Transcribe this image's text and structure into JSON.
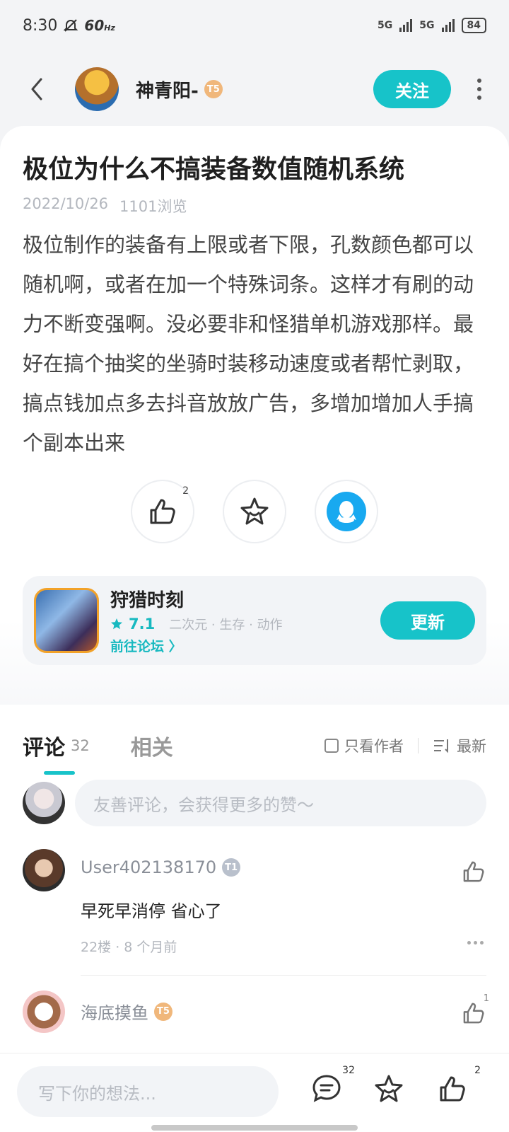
{
  "status_bar": {
    "time": "8:30",
    "refresh_rate": "60",
    "refresh_unit": "Hz",
    "network1": "5G",
    "network2": "5G",
    "battery": "84"
  },
  "header": {
    "author_name": "神青阳-",
    "author_level": "T5",
    "follow_label": "关注"
  },
  "post": {
    "title": "极位为什么不搞装备数值随机系统",
    "date": "2022/10/26",
    "views": "1101浏览",
    "body": "极位制作的装备有上限或者下限，孔数颜色都可以随机啊，或者在加一个特殊词条。这样才有刷的动力不断变强啊。没必要非和怪猎单机游戏那样。最好在搞个抽奖的坐骑时装移动速度或者帮忙剥取，搞点钱加点多去抖音放放广告，多增加增加人手搞个副本出来",
    "like_count": "2"
  },
  "game": {
    "name": "狩猎时刻",
    "rating": "7.1",
    "tags": "二次元 · 生存 · 动作",
    "forum_link": "前往论坛 〉",
    "update_label": "更新"
  },
  "comments_section": {
    "tab_comments": "评论",
    "tab_comments_count": "32",
    "tab_related": "相关",
    "filter_author_only": "只看作者",
    "sort_label": "最新",
    "input_placeholder": "友善评论，会获得更多的赞～",
    "items": [
      {
        "user": "User402138170",
        "level": "T1",
        "text": "早死早消停 省心了",
        "meta": "22楼 · 8 个月前",
        "likes": ""
      },
      {
        "user": "海底摸鱼",
        "level": "T5",
        "text": "",
        "meta": "",
        "likes": "1"
      }
    ]
  },
  "bottom_bar": {
    "input_placeholder": "写下你的想法...",
    "comment_count": "32",
    "like_count": "2"
  },
  "colors": {
    "accent": "#17c3c9",
    "badge_gold": "#f0b77b",
    "qq_blue": "#18a9f0"
  }
}
